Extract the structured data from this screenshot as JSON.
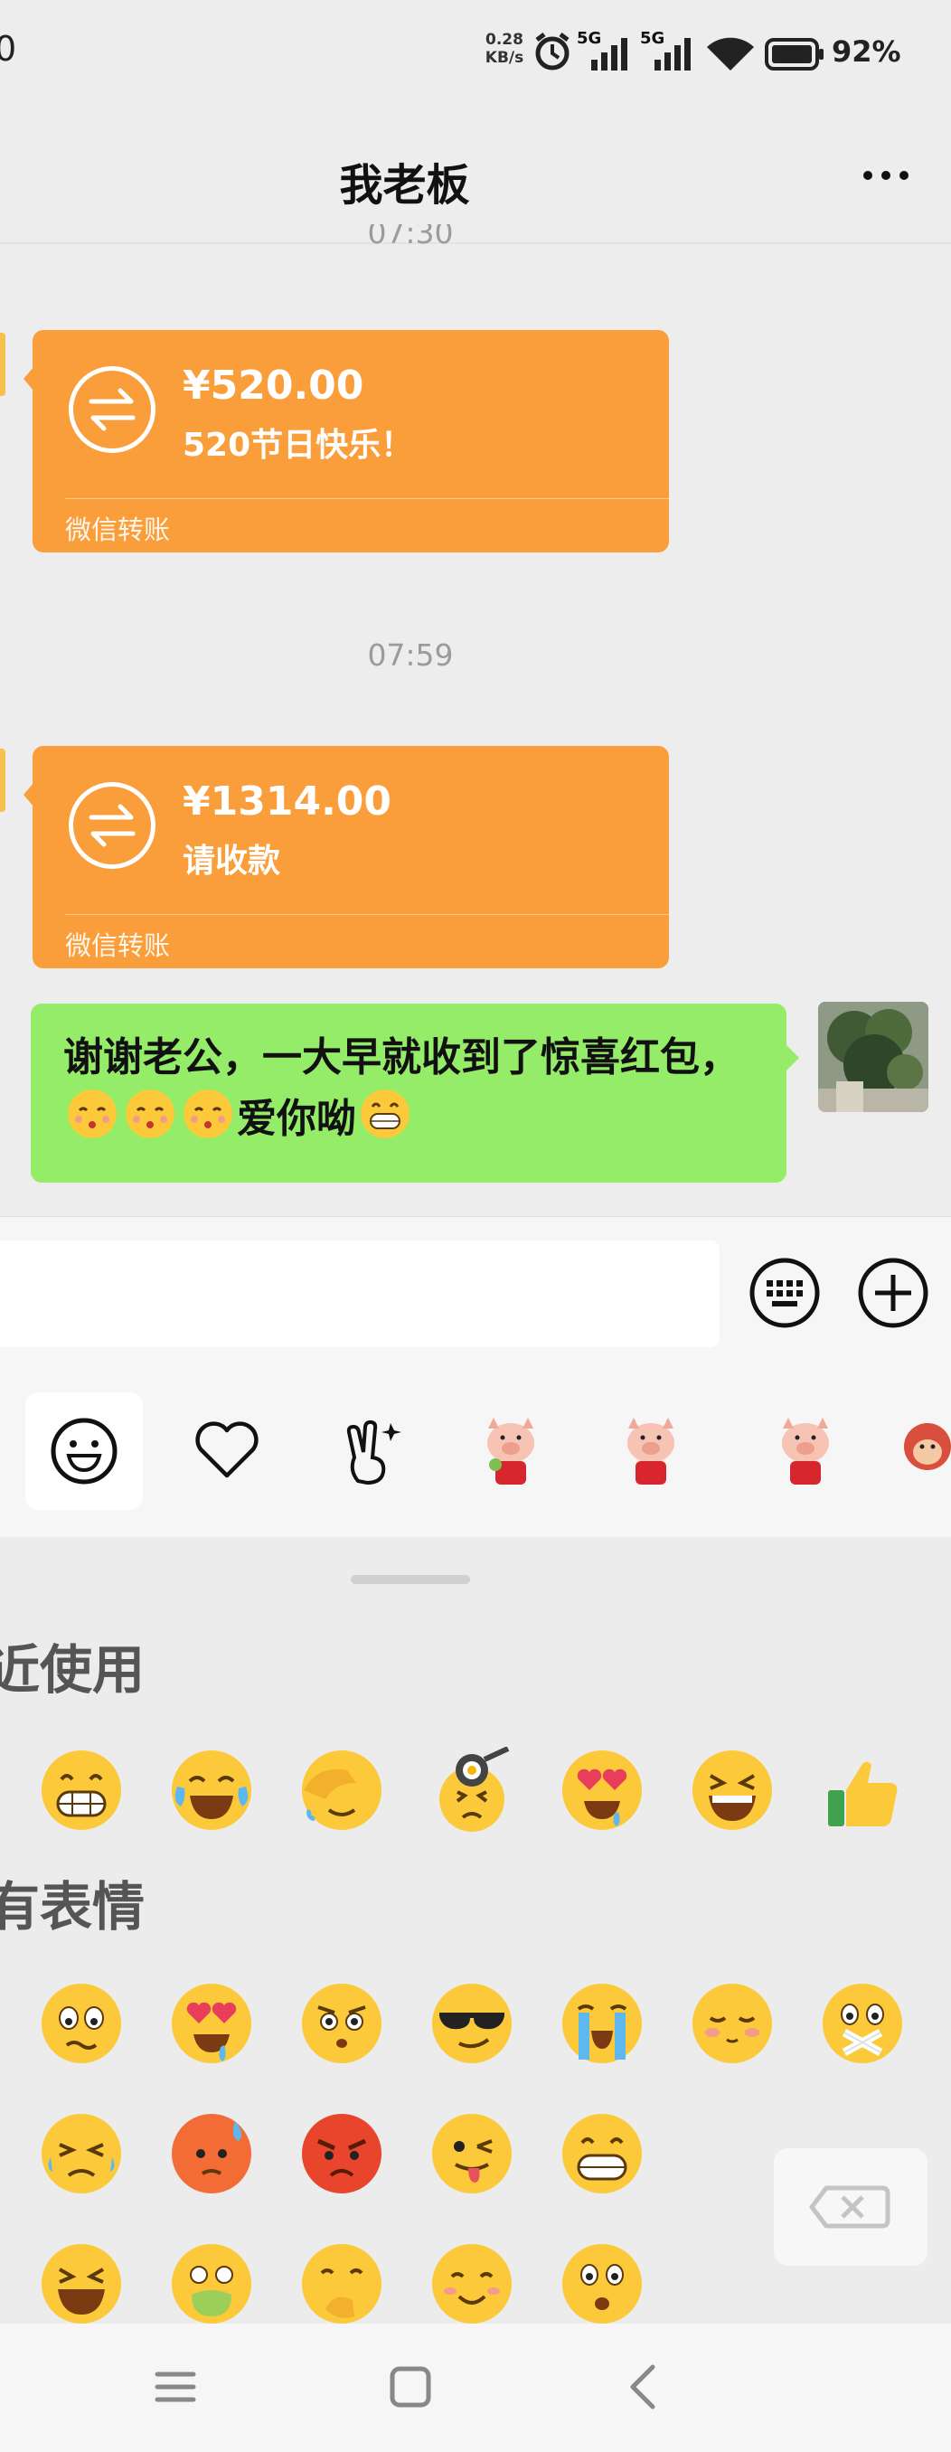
{
  "status_bar": {
    "time_fragment": "0",
    "network_speed": "0.28\nKB/s",
    "network_speed_value": "0.28",
    "network_speed_unit": "KB/s",
    "signal_1": "5G",
    "signal_2": "5G",
    "battery_percent": "92%"
  },
  "header": {
    "title": "我老板",
    "partial_time": "07:30"
  },
  "messages": [
    {
      "type": "transfer",
      "amount": "¥520.00",
      "note": "520节日快乐！",
      "footer": "微信转账"
    },
    {
      "type": "time",
      "time": "07:59"
    },
    {
      "type": "transfer",
      "amount": "¥1314.00",
      "note": "请收款",
      "footer": "微信转账"
    },
    {
      "type": "text",
      "text_part1": "谢谢老公，一大早就收到了惊喜红包，",
      "text_part2": "爱你呦"
    }
  ],
  "emoji_panel": {
    "recent_title": "近使用",
    "all_title": "有表情"
  },
  "colors": {
    "transfer_orange": "#fa9e3b",
    "my_bubble_green": "#95ec69",
    "background": "#ededed"
  }
}
